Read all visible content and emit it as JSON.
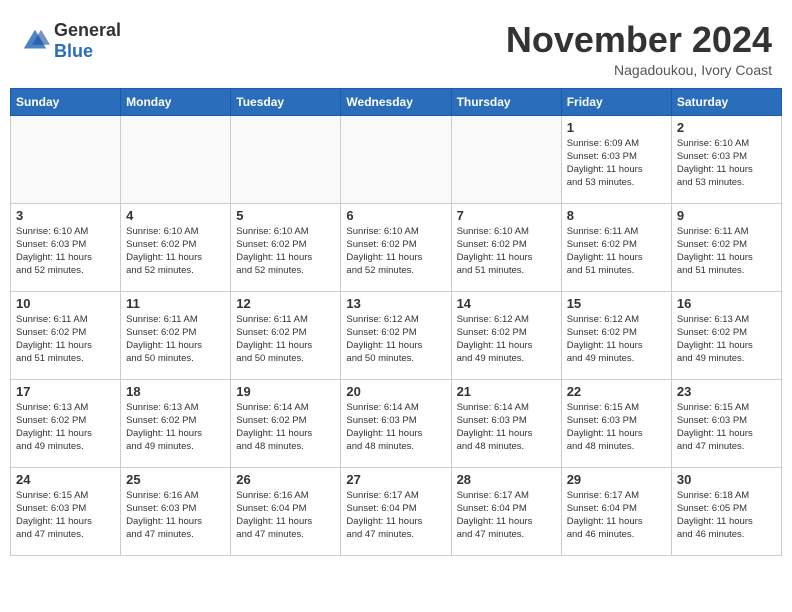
{
  "header": {
    "logo_general": "General",
    "logo_blue": "Blue",
    "month_year": "November 2024",
    "location": "Nagadoukou, Ivory Coast"
  },
  "weekdays": [
    "Sunday",
    "Monday",
    "Tuesday",
    "Wednesday",
    "Thursday",
    "Friday",
    "Saturday"
  ],
  "weeks": [
    [
      {
        "day": "",
        "info": ""
      },
      {
        "day": "",
        "info": ""
      },
      {
        "day": "",
        "info": ""
      },
      {
        "day": "",
        "info": ""
      },
      {
        "day": "",
        "info": ""
      },
      {
        "day": "1",
        "info": "Sunrise: 6:09 AM\nSunset: 6:03 PM\nDaylight: 11 hours\nand 53 minutes."
      },
      {
        "day": "2",
        "info": "Sunrise: 6:10 AM\nSunset: 6:03 PM\nDaylight: 11 hours\nand 53 minutes."
      }
    ],
    [
      {
        "day": "3",
        "info": "Sunrise: 6:10 AM\nSunset: 6:03 PM\nDaylight: 11 hours\nand 52 minutes."
      },
      {
        "day": "4",
        "info": "Sunrise: 6:10 AM\nSunset: 6:02 PM\nDaylight: 11 hours\nand 52 minutes."
      },
      {
        "day": "5",
        "info": "Sunrise: 6:10 AM\nSunset: 6:02 PM\nDaylight: 11 hours\nand 52 minutes."
      },
      {
        "day": "6",
        "info": "Sunrise: 6:10 AM\nSunset: 6:02 PM\nDaylight: 11 hours\nand 52 minutes."
      },
      {
        "day": "7",
        "info": "Sunrise: 6:10 AM\nSunset: 6:02 PM\nDaylight: 11 hours\nand 51 minutes."
      },
      {
        "day": "8",
        "info": "Sunrise: 6:11 AM\nSunset: 6:02 PM\nDaylight: 11 hours\nand 51 minutes."
      },
      {
        "day": "9",
        "info": "Sunrise: 6:11 AM\nSunset: 6:02 PM\nDaylight: 11 hours\nand 51 minutes."
      }
    ],
    [
      {
        "day": "10",
        "info": "Sunrise: 6:11 AM\nSunset: 6:02 PM\nDaylight: 11 hours\nand 51 minutes."
      },
      {
        "day": "11",
        "info": "Sunrise: 6:11 AM\nSunset: 6:02 PM\nDaylight: 11 hours\nand 50 minutes."
      },
      {
        "day": "12",
        "info": "Sunrise: 6:11 AM\nSunset: 6:02 PM\nDaylight: 11 hours\nand 50 minutes."
      },
      {
        "day": "13",
        "info": "Sunrise: 6:12 AM\nSunset: 6:02 PM\nDaylight: 11 hours\nand 50 minutes."
      },
      {
        "day": "14",
        "info": "Sunrise: 6:12 AM\nSunset: 6:02 PM\nDaylight: 11 hours\nand 49 minutes."
      },
      {
        "day": "15",
        "info": "Sunrise: 6:12 AM\nSunset: 6:02 PM\nDaylight: 11 hours\nand 49 minutes."
      },
      {
        "day": "16",
        "info": "Sunrise: 6:13 AM\nSunset: 6:02 PM\nDaylight: 11 hours\nand 49 minutes."
      }
    ],
    [
      {
        "day": "17",
        "info": "Sunrise: 6:13 AM\nSunset: 6:02 PM\nDaylight: 11 hours\nand 49 minutes."
      },
      {
        "day": "18",
        "info": "Sunrise: 6:13 AM\nSunset: 6:02 PM\nDaylight: 11 hours\nand 49 minutes."
      },
      {
        "day": "19",
        "info": "Sunrise: 6:14 AM\nSunset: 6:02 PM\nDaylight: 11 hours\nand 48 minutes."
      },
      {
        "day": "20",
        "info": "Sunrise: 6:14 AM\nSunset: 6:03 PM\nDaylight: 11 hours\nand 48 minutes."
      },
      {
        "day": "21",
        "info": "Sunrise: 6:14 AM\nSunset: 6:03 PM\nDaylight: 11 hours\nand 48 minutes."
      },
      {
        "day": "22",
        "info": "Sunrise: 6:15 AM\nSunset: 6:03 PM\nDaylight: 11 hours\nand 48 minutes."
      },
      {
        "day": "23",
        "info": "Sunrise: 6:15 AM\nSunset: 6:03 PM\nDaylight: 11 hours\nand 47 minutes."
      }
    ],
    [
      {
        "day": "24",
        "info": "Sunrise: 6:15 AM\nSunset: 6:03 PM\nDaylight: 11 hours\nand 47 minutes."
      },
      {
        "day": "25",
        "info": "Sunrise: 6:16 AM\nSunset: 6:03 PM\nDaylight: 11 hours\nand 47 minutes."
      },
      {
        "day": "26",
        "info": "Sunrise: 6:16 AM\nSunset: 6:04 PM\nDaylight: 11 hours\nand 47 minutes."
      },
      {
        "day": "27",
        "info": "Sunrise: 6:17 AM\nSunset: 6:04 PM\nDaylight: 11 hours\nand 47 minutes."
      },
      {
        "day": "28",
        "info": "Sunrise: 6:17 AM\nSunset: 6:04 PM\nDaylight: 11 hours\nand 47 minutes."
      },
      {
        "day": "29",
        "info": "Sunrise: 6:17 AM\nSunset: 6:04 PM\nDaylight: 11 hours\nand 46 minutes."
      },
      {
        "day": "30",
        "info": "Sunrise: 6:18 AM\nSunset: 6:05 PM\nDaylight: 11 hours\nand 46 minutes."
      }
    ]
  ]
}
